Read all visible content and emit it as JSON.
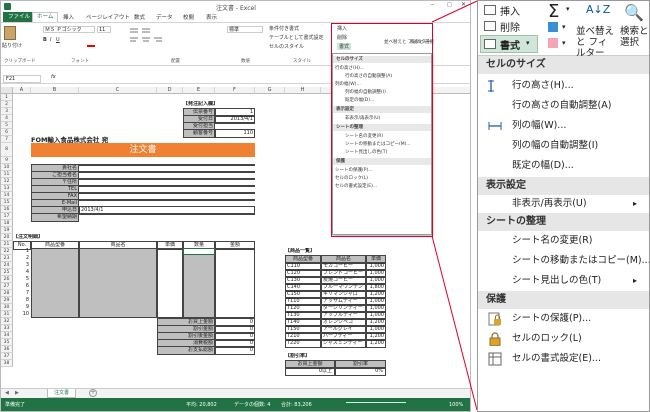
{
  "excel": {
    "title": "注文書 - Excel",
    "window_user": "サインイン",
    "tabs": [
      "ファイル",
      "ホーム",
      "挿入",
      "ページレイアウト",
      "数式",
      "データ",
      "校閲",
      "表示"
    ],
    "ribbon": {
      "paste": "貼り付け",
      "font_name": "ＭＳ Ｐゴシック",
      "font_size": "11",
      "number_format": "標準",
      "cond_format": "条件付き書式",
      "table_format": "テーブルとして書式設定",
      "cell_style": "セルのスタイル",
      "insert": "挿入",
      "delete": "削除",
      "format": "書式",
      "sort": "並べ替えと フィルター",
      "find": "検索と 選択",
      "groups": [
        "クリップボード",
        "フォント",
        "配置",
        "数値",
        "スタイル"
      ]
    },
    "name_box": "F21",
    "sheet_tab": "注文書",
    "status_ready": "準備完了",
    "status_avg": "平均: 20,802",
    "status_count": "データの個数: 4",
    "status_sum": "合計: 83,206",
    "zoom": "100%",
    "columns": [
      "A",
      "B",
      "C",
      "D",
      "E",
      "F",
      "G",
      "H",
      "I",
      "J",
      "K"
    ],
    "rows": [
      "1",
      "2",
      "3",
      "4",
      "5",
      "6",
      "7",
      "8",
      "9",
      "10",
      "11",
      "12",
      "13",
      "14",
      "15",
      "16",
      "17",
      "18",
      "19",
      "20",
      "21",
      "22",
      "23",
      "24",
      "25",
      "26",
      "27",
      "28",
      "29",
      "30",
      "31",
      "32",
      "33",
      "34",
      "35",
      "36",
      "37",
      "38"
    ],
    "order_info": {
      "header": "【発注記入欄】",
      "labels": [
        "伝票番号",
        "受付日",
        "受付担当",
        "顧客番号"
      ],
      "values": [
        "1",
        "2013/4/1",
        "",
        "110"
      ]
    },
    "company": "FOM輸入食品株式会社 宛",
    "form_title": "注文書",
    "customer_labels": [
      "貴社名",
      "ご担当者名",
      "〒住所",
      "TEL",
      "FAX",
      "E-Mail",
      "申込日",
      "希望納期"
    ],
    "apply_date": "2013/4/1",
    "detail_header": "【注文明細】",
    "detail_cols": [
      "No.",
      "商品型番",
      "商品名",
      "単価",
      "数量",
      "金額"
    ],
    "detail_rows": [
      "1",
      "2",
      "3",
      "4",
      "5",
      "6",
      "7",
      "8",
      "9",
      "10"
    ],
    "totals": {
      "labels": [
        "お買上金額",
        "割引金額",
        "割引後金額",
        "消費税額",
        "お支払総額"
      ],
      "values": [
        "0",
        "0",
        "0",
        "0",
        "0"
      ]
    },
    "product_header": "【商品一覧】",
    "product_cols": [
      "商品型番",
      "商品名",
      "単価"
    ],
    "products": [
      [
        "C110",
        "モカコーヒー",
        "1,000"
      ],
      [
        "C120",
        "ブレンドコーヒー",
        "1,000"
      ],
      [
        "C130",
        "炭焼コーヒー",
        "1,000"
      ],
      [
        "C140",
        "ブルーマウンテン",
        "1,800"
      ],
      [
        "C150",
        "キリマンジャロ",
        "1,200"
      ],
      [
        "T110",
        "アッサムティー",
        "1,000"
      ],
      [
        "T120",
        "ダージリンティー",
        "1,000"
      ],
      [
        "T130",
        "アップルティー",
        "1,000"
      ],
      [
        "T140",
        "オレンジペコ",
        "1,200"
      ],
      [
        "T150",
        "アールグレイ",
        "1,000"
      ],
      [
        "T210",
        "ハーブティー",
        "1,200"
      ],
      [
        "T220",
        "ジャスミンティー",
        "1,200"
      ]
    ],
    "discount_header": "【割引率】",
    "discount_cols": [
      "お買上金額",
      "割引率"
    ],
    "discount_row": [
      "0以上",
      "0%"
    ],
    "mini_menu": {
      "s1": "セルのサイズ",
      "i1": [
        "行の高さ(H)...",
        "行の高さの自動調整(A)",
        "列の幅(W)...",
        "列の幅の自動調整(I)",
        "既定の幅(D)..."
      ],
      "s2": "表示設定",
      "i2": [
        "非表示/再表示(U)"
      ],
      "s3": "シートの整理",
      "i3": [
        "シート名の変更(R)",
        "シートの移動またはコピー(M)...",
        "シート見出しの色(T)"
      ],
      "s4": "保護",
      "i4": [
        "シートの保護(P)...",
        "セルのロック(L)",
        "セルの書式設定(E)..."
      ]
    }
  },
  "zoom": {
    "insert": "挿入",
    "delete": "削除",
    "format": "書式",
    "sigma": "Σ",
    "sort": "並べ替えと フィルター",
    "find": "検索と 選択",
    "sections": [
      "セルのサイズ",
      "表示設定",
      "シートの整理",
      "保護"
    ],
    "size_items": [
      {
        "label": "行の高さ(H)...",
        "icon": "row-height-icon"
      },
      {
        "label": "行の高さの自動調整(A)",
        "icon": ""
      },
      {
        "label": "列の幅(W)...",
        "icon": "column-width-icon"
      },
      {
        "label": "列の幅の自動調整(I)",
        "icon": ""
      },
      {
        "label": "既定の幅(D)...",
        "icon": ""
      }
    ],
    "visibility_items": [
      {
        "label": "非表示/再表示(U)",
        "icon": ""
      }
    ],
    "organize_items": [
      {
        "label": "シート名の変更(R)",
        "icon": ""
      },
      {
        "label": "シートの移動またはコピー(M)...",
        "icon": ""
      },
      {
        "label": "シート見出しの色(T)",
        "icon": ""
      }
    ],
    "protect_items": [
      {
        "label": "シートの保護(P)...",
        "icon": "protect-sheet-icon"
      },
      {
        "label": "セルのロック(L)",
        "icon": "lock-cell-icon"
      },
      {
        "label": "セルの書式設定(E)...",
        "icon": "format-cells-icon"
      }
    ]
  },
  "colors": {
    "excel_green": "#217346",
    "orange": "#f08032",
    "gray_fill": "#bfbfbf",
    "highlight_red": "#e0002a"
  }
}
